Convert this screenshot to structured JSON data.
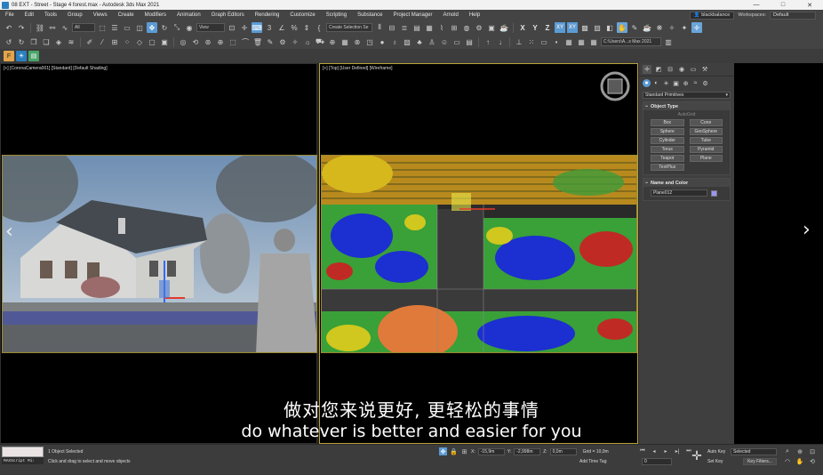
{
  "window": {
    "title": "08 EXT - Street - Stage 4 forest.max - Autodesk 3ds Max 2021",
    "controls": [
      "—",
      "□",
      "✕"
    ]
  },
  "menubar": {
    "items": [
      "File",
      "Edit",
      "Tools",
      "Group",
      "Views",
      "Create",
      "Modifiers",
      "Animation",
      "Graph Editors",
      "Rendering",
      "Customize",
      "Scripting",
      "Substance",
      "Project Manager",
      "Arnold",
      "Help"
    ],
    "user": "blackbalance",
    "workspaces_label": "Workspaces:",
    "workspace_value": "Default"
  },
  "toolbar": {
    "selection_filter": "All",
    "reference_coord": "View",
    "named_selection": "Create Selection Se",
    "path": "C:\\Users\\A...s Max 2021",
    "axis_letters": [
      "X",
      "Y",
      "Z",
      "XY",
      "XY"
    ]
  },
  "viewports": {
    "left_label": "[+] [CoronaCamera001] [Standard] [Default Shading]",
    "right_label": "[+] [Top] [User Defined] [Wireframe]"
  },
  "caption": {
    "zh": "做对您来说更好, 更轻松的事情",
    "en": "do whatever is better and easier for you"
  },
  "command_panel": {
    "category": "Standard Primitives",
    "object_type_title": "Object Type",
    "autogrid_label": "AutoGrid",
    "object_buttons": [
      "Box",
      "Cone",
      "Sphere",
      "GeoSphere",
      "Cylinder",
      "Tube",
      "Torus",
      "Pyramid",
      "Teapot",
      "Plane",
      "TextPlus"
    ],
    "name_color_title": "Name and Color",
    "name_value": "Plane012",
    "swatch_color": "#9a95ff"
  },
  "status": {
    "maxscript_label": "MAXScript Mi:",
    "objects_selected": "1 Object Selected",
    "prompt": "Click and drag to select and move objects",
    "x_label": "X:",
    "x_value": "-15,9m",
    "y_label": "Y:",
    "y_value": "-2,998m",
    "z_label": "Z:",
    "z_value": "0,0m",
    "grid": "Grid = 10,0m",
    "add_time_tag": "Add Time Tag",
    "frame": "0",
    "auto_key": "Auto Key",
    "set_key": "Set Key",
    "selected": "Selected",
    "key_filters": "Key Filters..."
  },
  "colors": {
    "accent": "#5b9bd5",
    "viewport_border": "#b8a13a"
  }
}
